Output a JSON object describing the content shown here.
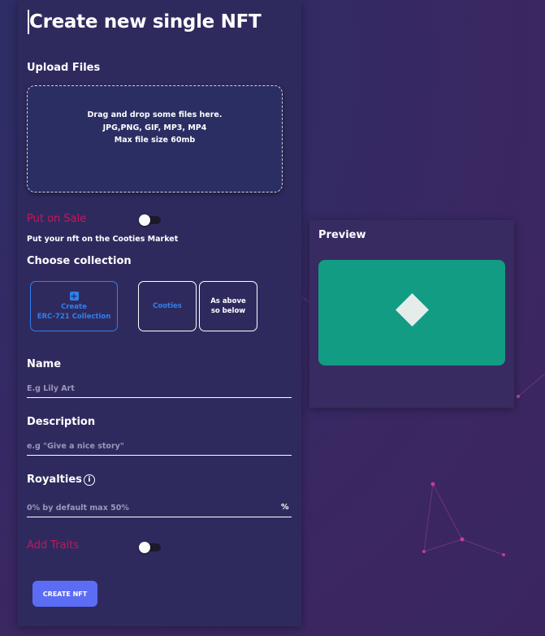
{
  "form": {
    "title": "Create new single NFT",
    "upload": {
      "label": "Upload Files",
      "line1": "Drag and drop some files here.",
      "line2": "JPG,PNG, GIF, MP3, MP4",
      "line3": "Max file size 60mb"
    },
    "sale": {
      "label": "Put on Sale",
      "description": "Put your nft on the Cooties Market",
      "enabled": false
    },
    "collection": {
      "label": "Choose collection",
      "create_line1": "Create",
      "create_line2": "ERC-721 Collection",
      "options": [
        "Cooties",
        "As above so below"
      ]
    },
    "name": {
      "label": "Name",
      "placeholder": "E.g Lily Art",
      "value": ""
    },
    "description": {
      "label": "Description",
      "placeholder": "e.g \"Give a nice story\"",
      "value": ""
    },
    "royalties": {
      "label": "Royalties",
      "placeholder": "0% by default max 50%",
      "unit": "%",
      "value": ""
    },
    "traits": {
      "label": "Add Traits",
      "enabled": false
    },
    "submit_label": "CREATE NFT"
  },
  "preview": {
    "title": "Preview"
  },
  "colors": {
    "accent_pink": "#c2185b",
    "accent_blue": "#2f80ed",
    "button": "#5b6cf5",
    "preview_bg": "#129c83"
  },
  "icons": [
    "plus-icon",
    "info-icon",
    "diamond-icon"
  ]
}
